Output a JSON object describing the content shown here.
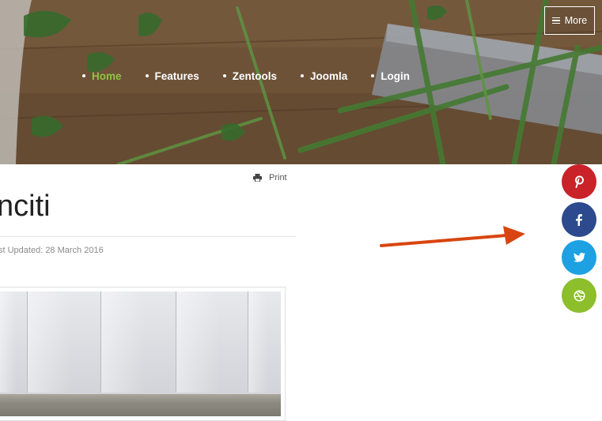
{
  "header": {
    "nav": [
      {
        "label": "Home",
        "active": true
      },
      {
        "label": "Features",
        "active": false
      },
      {
        "label": "Zentools",
        "active": false
      },
      {
        "label": "Joomla",
        "active": false
      },
      {
        "label": "Login",
        "active": false
      }
    ],
    "more_label": "More"
  },
  "article": {
    "print_label": "Print",
    "title": "nciti",
    "last_updated": "st Updated: 28 March 2016"
  },
  "social": [
    {
      "network": "pinterest",
      "icon": "pinterest-icon",
      "color": "#c92228"
    },
    {
      "network": "facebook",
      "icon": "facebook-icon",
      "color": "#2c4a8d"
    },
    {
      "network": "twitter",
      "icon": "twitter-icon",
      "color": "#1da1e2"
    },
    {
      "network": "dribbble",
      "icon": "dribbble-icon",
      "color": "#8cbf2b"
    }
  ],
  "colors": {
    "accent": "#8dc641",
    "arrow": "#d94510"
  }
}
